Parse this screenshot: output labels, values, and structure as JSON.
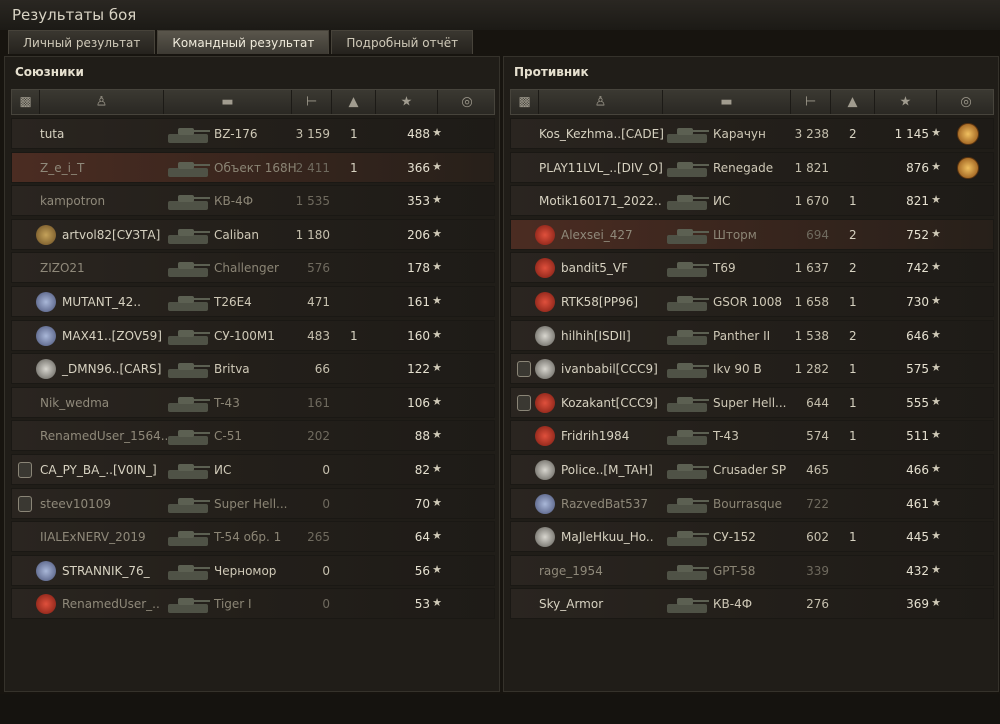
{
  "window": {
    "title": "Результаты боя"
  },
  "tabs": [
    {
      "label": "Личный результат"
    },
    {
      "label": "Командный результат"
    },
    {
      "label": "Подробный отчёт"
    }
  ],
  "allies": {
    "title": "Союзники",
    "rows": [
      {
        "name": "tuta",
        "tank": "BZ-176",
        "damage": "3 159",
        "kills": "1",
        "xp": "488"
      },
      {
        "name": "Z_e_i_T",
        "tank": "Объект 168Н",
        "damage": "2 411",
        "kills": "1",
        "xp": "366"
      },
      {
        "name": "kampotron",
        "tank": "КВ-4Ф",
        "damage": "1 535",
        "kills": "",
        "xp": "353"
      },
      {
        "name": "artvol82[СУЗТА]",
        "tank": "Caliban",
        "damage": "1 180",
        "kills": "",
        "xp": "206"
      },
      {
        "name": "ZIZO21",
        "tank": "Challenger",
        "damage": "576",
        "kills": "",
        "xp": "178"
      },
      {
        "name": "MUTANT_42..",
        "tank": "T26E4",
        "damage": "471",
        "kills": "",
        "xp": "161"
      },
      {
        "name": "MAX41..[ZOV59]",
        "tank": "СУ-100М1",
        "damage": "483",
        "kills": "1",
        "xp": "160"
      },
      {
        "name": "_DMN96..[CARS]",
        "tank": "Britva",
        "damage": "66",
        "kills": "",
        "xp": "122"
      },
      {
        "name": "Nik_wedma",
        "tank": "T-43",
        "damage": "161",
        "kills": "",
        "xp": "106"
      },
      {
        "name": "RenamedUser_1564..",
        "tank": "С-51",
        "damage": "202",
        "kills": "",
        "xp": "88"
      },
      {
        "name": "CA_PY_BA_..[V0IN_]",
        "tank": "ИС",
        "damage": "0",
        "kills": "",
        "xp": "82"
      },
      {
        "name": "steev10109",
        "tank": "Super Hell...",
        "damage": "0",
        "kills": "",
        "xp": "70"
      },
      {
        "name": "IIALExNERV_2019",
        "tank": "T-54 обр. 1",
        "damage": "265",
        "kills": "",
        "xp": "64"
      },
      {
        "name": "STRANNIK_76_",
        "tank": "Черномор",
        "damage": "0",
        "kills": "",
        "xp": "56"
      },
      {
        "name": "RenamedUser_..",
        "tank": "Tiger I",
        "damage": "0",
        "kills": "",
        "xp": "53"
      }
    ]
  },
  "enemies": {
    "title": "Противник",
    "rows": [
      {
        "name": "Kos_Kezhma..[CADE]",
        "tank": "Карачун",
        "damage": "3 238",
        "kills": "2",
        "xp": "1 145"
      },
      {
        "name": "PLAY11LVL_..[DIV_O]",
        "tank": "Renegade",
        "damage": "1 821",
        "kills": "",
        "xp": "876"
      },
      {
        "name": "Motik160171_2022..",
        "tank": "ИС",
        "damage": "1 670",
        "kills": "1",
        "xp": "821"
      },
      {
        "name": "Alexsei_427",
        "tank": "Шторм",
        "damage": "694",
        "kills": "2",
        "xp": "752"
      },
      {
        "name": "bandit5_VF",
        "tank": "T69",
        "damage": "1 637",
        "kills": "2",
        "xp": "742"
      },
      {
        "name": "RTK58[PP96]",
        "tank": "GSOR 1008",
        "damage": "1 658",
        "kills": "1",
        "xp": "730"
      },
      {
        "name": "hilhih[ISDII]",
        "tank": "Panther II",
        "damage": "1 538",
        "kills": "2",
        "xp": "646"
      },
      {
        "name": "ivanbabil[CCC9]",
        "tank": "Ikv 90 B",
        "damage": "1 282",
        "kills": "1",
        "xp": "575"
      },
      {
        "name": "Kozakant[CCC9]",
        "tank": "Super Hell...",
        "damage": "644",
        "kills": "1",
        "xp": "555"
      },
      {
        "name": "Fridrih1984",
        "tank": "T-43",
        "damage": "574",
        "kills": "1",
        "xp": "511"
      },
      {
        "name": "Police..[M_TAH]",
        "tank": "Crusader SP",
        "damage": "465",
        "kills": "",
        "xp": "466"
      },
      {
        "name": "RazvedBat537",
        "tank": "Bourrasque",
        "damage": "722",
        "kills": "",
        "xp": "461"
      },
      {
        "name": "MaJleHkuu_Ho..",
        "tank": "СУ-152",
        "damage": "602",
        "kills": "1",
        "xp": "445"
      },
      {
        "name": "rage_1954",
        "tank": "GPT-58",
        "damage": "339",
        "kills": "",
        "xp": "432"
      },
      {
        "name": "Sky_Armor",
        "tank": "КВ-4Ф",
        "damage": "276",
        "kills": "",
        "xp": "369"
      }
    ]
  }
}
